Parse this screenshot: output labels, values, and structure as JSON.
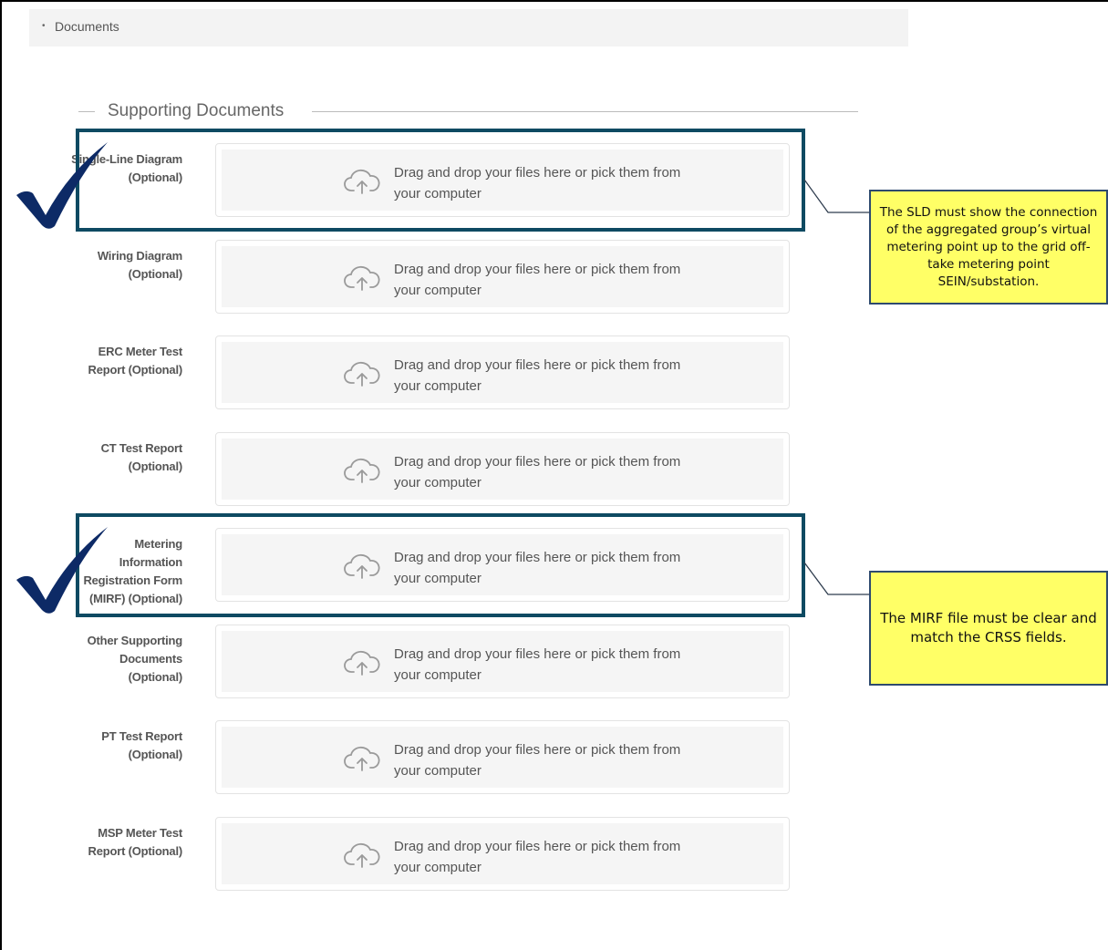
{
  "section": {
    "bullet": "•",
    "title": "Documents"
  },
  "group": {
    "title": "Supporting Documents"
  },
  "dropzone_text": "Drag and drop your files here or pick them from your computer",
  "rows": [
    {
      "label": "Single-Line Diagram (Optional)"
    },
    {
      "label": "Wiring Diagram (Optional)"
    },
    {
      "label": "ERC Meter Test Report (Optional)"
    },
    {
      "label": "CT Test Report (Optional)"
    },
    {
      "label": "Metering Information Registration Form (MIRF) (Optional)"
    },
    {
      "label": "Other Supporting Documents (Optional)"
    },
    {
      "label": "PT Test Report (Optional)"
    },
    {
      "label": "MSP Meter Test Report (Optional)"
    }
  ],
  "annotations": [
    {
      "text": "The SLD must show the connection of the aggregated group’s virtual metering point up to the grid off-take metering point SEIN/substation."
    },
    {
      "text": "The MIRF file must be clear and match the CRSS fields."
    }
  ],
  "icons": {
    "upload": "cloud-upload-icon",
    "check": "checkmark-icon"
  },
  "colors": {
    "highlight": "#0e4a62",
    "check": "#0d2a66",
    "note_bg": "#ffff66",
    "note_border": "#2e4a6e"
  }
}
